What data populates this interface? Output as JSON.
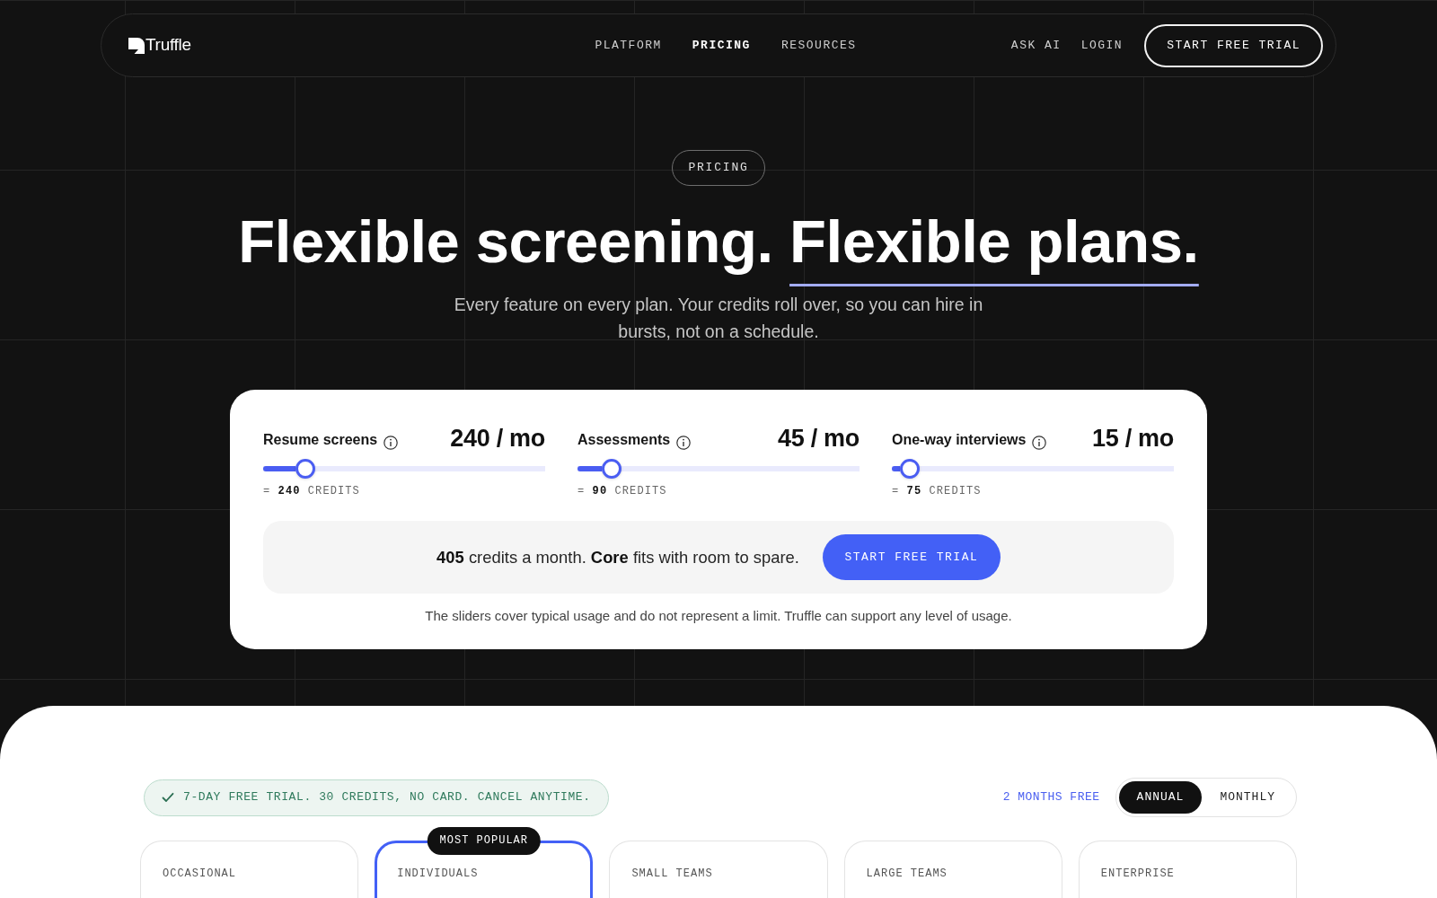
{
  "nav": {
    "logo": "Truffle",
    "links": [
      {
        "label": "PLATFORM",
        "selected": false
      },
      {
        "label": "PRICING",
        "selected": true
      },
      {
        "label": "RESOURCES",
        "selected": false
      }
    ],
    "actions": [
      {
        "label": "ASK AI",
        "kind": "link"
      },
      {
        "label": "LOGIN",
        "kind": "link"
      },
      {
        "label": "START FREE TRIAL",
        "kind": "button"
      }
    ]
  },
  "hero": {
    "eyebrow": "PRICING",
    "headline": [
      {
        "text": "Flexible screening.",
        "underline": false
      },
      {
        "text": "Flexible plans.",
        "underline": true
      }
    ],
    "subtitle": "Every feature on every plan. Your credits roll over, so you can hire in bursts, not on a schedule."
  },
  "calculator": {
    "sliders": [
      {
        "label": "Resume screens",
        "value": "240 / mo",
        "level": 0.15,
        "credits": "= **240** CREDITS"
      },
      {
        "label": "Assessments",
        "value": "45 / mo",
        "level": 0.12,
        "credits": "= **90** CREDITS"
      },
      {
        "label": "One-way interviews",
        "value": "15 / mo",
        "level": 0.065,
        "credits": "= **75** CREDITS"
      }
    ],
    "summary": "**405** credits a month. **Core** fits with room to spare.",
    "button": "START FREE TRIAL",
    "note": "The sliders cover typical usage and do not represent a limit. Truffle can support any level of usage."
  },
  "plans": {
    "trial_badge": "7-DAY FREE TRIAL. 30 CREDITS, NO CARD. CANCEL ANYTIME.",
    "discount": "2 MONTHS FREE",
    "billing": [
      {
        "label": "ANNUAL",
        "selected": true
      },
      {
        "label": "MONTHLY",
        "selected": false
      }
    ],
    "cards": [
      {
        "name": "OCCASIONAL",
        "featured": false
      },
      {
        "name": "INDIVIDUALS",
        "featured": true,
        "badge": "MOST POPULAR"
      },
      {
        "name": "SMALL TEAMS",
        "featured": false
      },
      {
        "name": "LARGE TEAMS",
        "featured": false
      },
      {
        "name": "ENTERPRISE",
        "featured": false
      }
    ]
  }
}
